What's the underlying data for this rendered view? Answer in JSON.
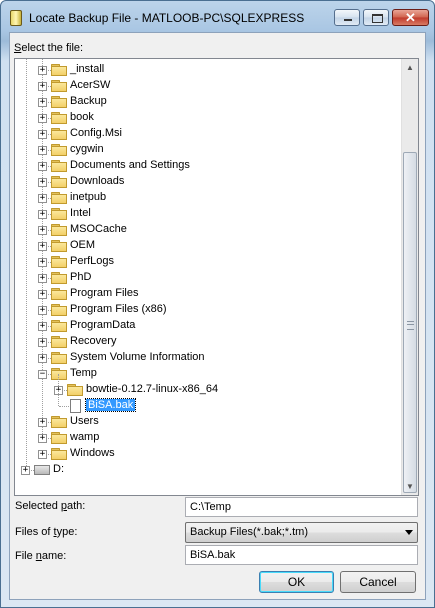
{
  "window": {
    "title": "Locate Backup File - MATLOOB-PC\\SQLEXPRESS",
    "controls": {
      "minimize": "minimize-icon",
      "maximize": "maximize-icon",
      "close_glyph": "✕"
    }
  },
  "prompt": {
    "label_pre": "",
    "label_u": "S",
    "label_post": "elect the file:"
  },
  "tree": {
    "items": [
      {
        "label": "_install",
        "type": "folder",
        "level": 1,
        "expander": "+"
      },
      {
        "label": "AcerSW",
        "type": "folder",
        "level": 1,
        "expander": "+"
      },
      {
        "label": "Backup",
        "type": "folder",
        "level": 1,
        "expander": "+"
      },
      {
        "label": "book",
        "type": "folder",
        "level": 1,
        "expander": "+"
      },
      {
        "label": "Config.Msi",
        "type": "folder",
        "level": 1,
        "expander": "+"
      },
      {
        "label": "cygwin",
        "type": "folder",
        "level": 1,
        "expander": "+"
      },
      {
        "label": "Documents and Settings",
        "type": "folder",
        "level": 1,
        "expander": "+"
      },
      {
        "label": "Downloads",
        "type": "folder",
        "level": 1,
        "expander": "+"
      },
      {
        "label": "inetpub",
        "type": "folder",
        "level": 1,
        "expander": "+"
      },
      {
        "label": "Intel",
        "type": "folder",
        "level": 1,
        "expander": "+"
      },
      {
        "label": "MSOCache",
        "type": "folder",
        "level": 1,
        "expander": "+"
      },
      {
        "label": "OEM",
        "type": "folder",
        "level": 1,
        "expander": "+"
      },
      {
        "label": "PerfLogs",
        "type": "folder",
        "level": 1,
        "expander": "+"
      },
      {
        "label": "PhD",
        "type": "folder",
        "level": 1,
        "expander": "+"
      },
      {
        "label": "Program Files",
        "type": "folder",
        "level": 1,
        "expander": "+"
      },
      {
        "label": "Program Files (x86)",
        "type": "folder",
        "level": 1,
        "expander": "+"
      },
      {
        "label": "ProgramData",
        "type": "folder",
        "level": 1,
        "expander": "+"
      },
      {
        "label": "Recovery",
        "type": "folder",
        "level": 1,
        "expander": "+"
      },
      {
        "label": "System Volume Information",
        "type": "folder",
        "level": 1,
        "expander": "+"
      },
      {
        "label": "Temp",
        "type": "folder",
        "level": 1,
        "expander": "−"
      },
      {
        "label": "bowtie-0.12.7-linux-x86_64",
        "type": "folder",
        "level": 2,
        "expander": "+"
      },
      {
        "label": "BiSA.bak",
        "type": "file",
        "level": 2,
        "expander": "",
        "selected": true
      },
      {
        "label": "Users",
        "type": "folder",
        "level": 1,
        "expander": "+"
      },
      {
        "label": "wamp",
        "type": "folder",
        "level": 1,
        "expander": "+"
      },
      {
        "label": "Windows",
        "type": "folder",
        "level": 1,
        "expander": "+"
      },
      {
        "label": "D:",
        "type": "drive",
        "level": 0,
        "expander": "+"
      }
    ],
    "scrollbar": {
      "up_glyph": "▲",
      "down_glyph": "▼"
    }
  },
  "form": {
    "selected_path": {
      "label_pre": "Selected ",
      "label_u": "p",
      "label_post": "ath:",
      "value": "C:\\Temp"
    },
    "files_of_type": {
      "label_pre": "Files of ",
      "label_u": "t",
      "label_post": "ype:",
      "value": "Backup Files(*.bak;*.tm)"
    },
    "file_name": {
      "label_pre": "File ",
      "label_u": "n",
      "label_post": "ame:",
      "value": "BiSA.bak"
    }
  },
  "buttons": {
    "ok": "OK",
    "cancel": "Cancel"
  }
}
